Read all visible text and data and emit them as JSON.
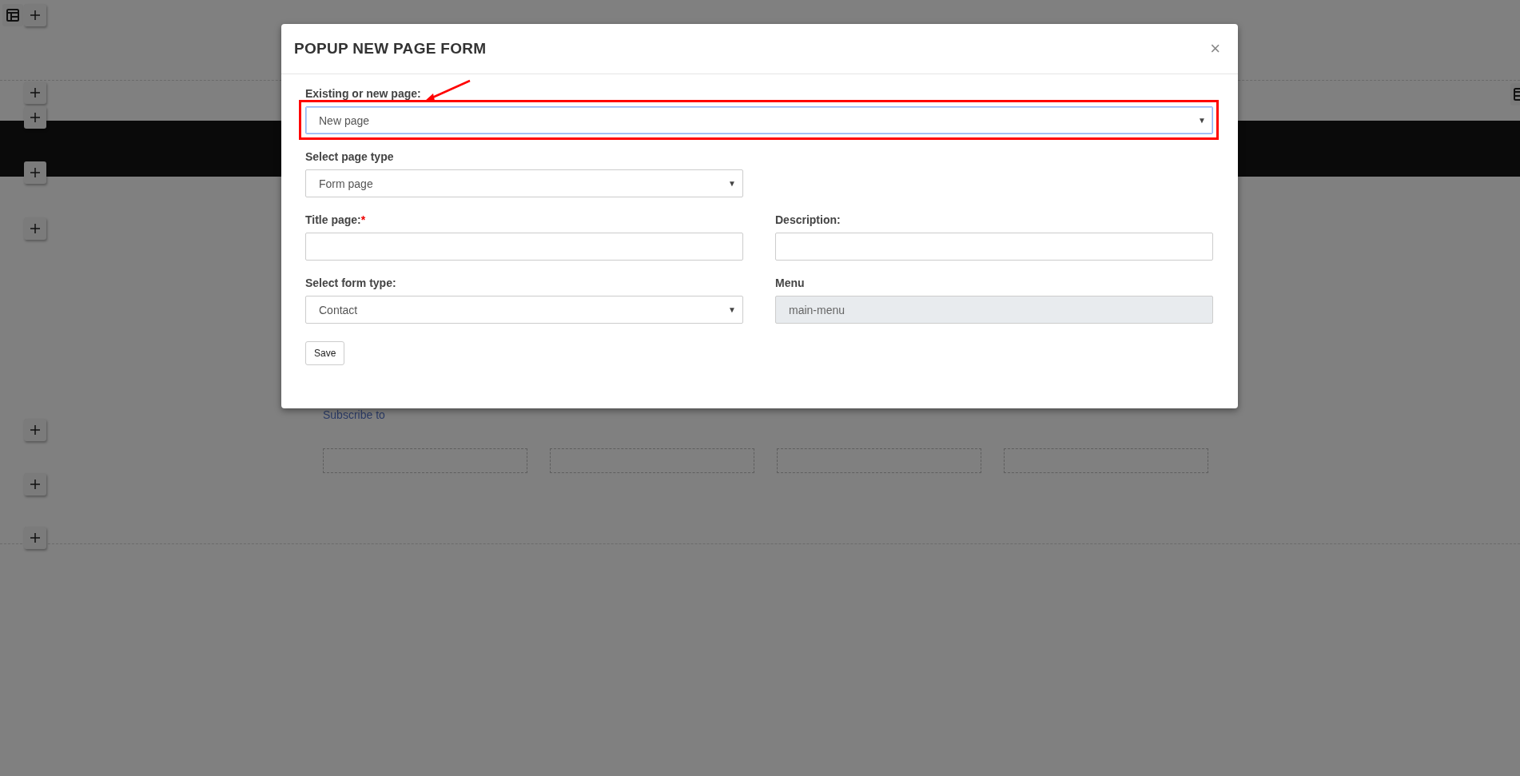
{
  "page": {
    "subscribe_text": "Subscribe to"
  },
  "modal": {
    "title": "POPUP NEW PAGE FORM",
    "close": "×",
    "rows": [
      [
        {
          "kind": "select",
          "label": "Existing or new page:",
          "value": "New page",
          "caret": "▼",
          "wide": true,
          "highlighted": true,
          "disabled": false
        }
      ],
      [
        {
          "kind": "select",
          "label": "Select page type",
          "value": "Form page",
          "caret": "▼",
          "wide": false,
          "highlighted": false,
          "disabled": false
        }
      ],
      [
        {
          "kind": "text",
          "label": "Title page:",
          "required_mark": "*",
          "wide": false,
          "highlighted": false,
          "disabled": false
        },
        {
          "kind": "text",
          "label": "Description:",
          "wide": false,
          "highlighted": false,
          "disabled": false
        }
      ],
      [
        {
          "kind": "select",
          "label": "Select form type:",
          "value": "Contact",
          "caret": "▼",
          "wide": false,
          "highlighted": false,
          "disabled": false
        },
        {
          "kind": "text",
          "label": "Menu",
          "value": "main-menu",
          "wide": false,
          "highlighted": false,
          "disabled": true
        }
      ]
    ],
    "save_button": "Save"
  }
}
